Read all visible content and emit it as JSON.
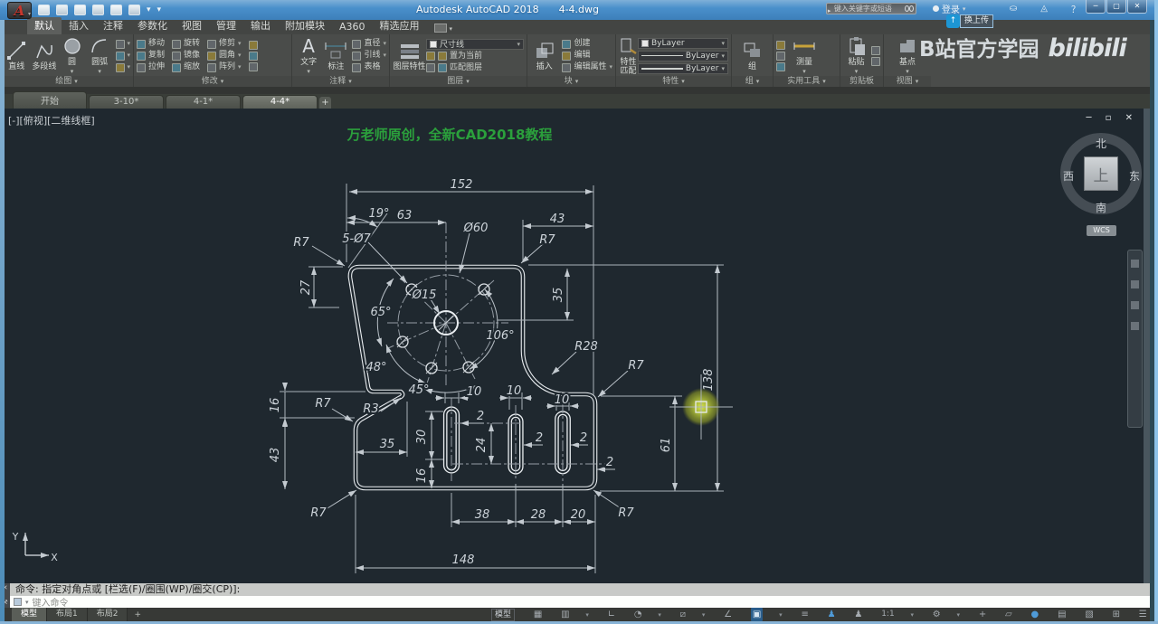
{
  "title_bar": {
    "app_title": "Autodesk AutoCAD 2018",
    "doc_name": "4-4.dwg",
    "search_placeholder": "键入关键字或短语",
    "signin_label": "登录",
    "upload_tooltip": "换上传"
  },
  "ribbon_tabs": [
    "默认",
    "插入",
    "注释",
    "参数化",
    "视图",
    "管理",
    "输出",
    "附加模块",
    "A360",
    "精选应用"
  ],
  "panels": {
    "draw": {
      "title": "绘图",
      "line": "直线",
      "pline": "多段线",
      "circle": "圆",
      "arc": "圆弧"
    },
    "modify": {
      "title": "修改",
      "move": "移动",
      "rotate": "旋转",
      "trim": "修剪",
      "copy": "复制",
      "mirror": "镜像",
      "fillet": "圆角",
      "stretch": "拉伸",
      "scale": "缩放",
      "array": "阵列"
    },
    "annotate": {
      "title": "注释",
      "text": "文字",
      "dim": "标注",
      "dia": "直径",
      "leader": "引线",
      "table": "表格"
    },
    "layers": {
      "title": "图层",
      "props": "图层特性",
      "layer_name": "尺寸线",
      "current": "置为当前",
      "match": "匹配图层"
    },
    "block": {
      "title": "块",
      "insert": "插入",
      "create": "创建",
      "edit": "编辑",
      "editattr": "编辑属性"
    },
    "properties": {
      "title": "特性",
      "match": "特性匹配",
      "bylayer1": "ByLayer",
      "bylayer2": "ByLayer",
      "bylayer3": "ByLayer"
    },
    "group": {
      "title": "组",
      "group": "组"
    },
    "utils": {
      "title": "实用工具",
      "measure": "测量"
    },
    "clipboard": {
      "title": "剪贴板",
      "paste": "粘贴"
    },
    "view": {
      "title": "视图",
      "base": "基点"
    }
  },
  "file_tabs": [
    "开始",
    "3-10*",
    "4-1*",
    "4-4*"
  ],
  "viewport": {
    "controls": "[-][俯视][二维线框]",
    "banner": "万老师原创，全新CAD2018教程",
    "viewcube": {
      "n": "北",
      "s": "南",
      "w": "西",
      "e": "东",
      "center": "上",
      "wcs": "WCS"
    }
  },
  "watermark": {
    "cn": "B站官方学园",
    "logo": "bilibili"
  },
  "drawing": {
    "labels": {
      "top152": "152",
      "ang19": "19°",
      "d63": "63",
      "d43": "43",
      "r7tl": "R7",
      "holes": "5-Ø7",
      "d60": "Ø60",
      "r7tr": "R7",
      "d27": "27",
      "d15": "Ø15",
      "d35r": "35",
      "a65": "65°",
      "a106": "106°",
      "r28": "R28",
      "a48": "48°",
      "a45": "45°",
      "r7mid": "R7",
      "d138": "138",
      "d61": "61",
      "r7notch": "R7",
      "r3": "R3",
      "d16l": "16",
      "d43l": "43",
      "d35n": "35",
      "d30": "30",
      "d24": "24",
      "d16b": "16",
      "d10a": "10",
      "d10b": "10",
      "d10c": "10",
      "t2a": "2",
      "t2b": "2",
      "t2c": "2",
      "t2d": "2",
      "d38": "38",
      "d28": "28",
      "d20": "20",
      "d148": "148",
      "r7bl": "R7",
      "r7br": "R7",
      "ucs_x": "X",
      "ucs_y": "Y"
    }
  },
  "command": {
    "history": "命令: 指定对角点或 [栏选(F)/圈围(WP)/圈交(CP)]:",
    "placeholder": "键入命令"
  },
  "statusbar": {
    "tabs": [
      "模型",
      "布局1",
      "布局2"
    ],
    "model_label": "模型",
    "scale": "1:1"
  }
}
